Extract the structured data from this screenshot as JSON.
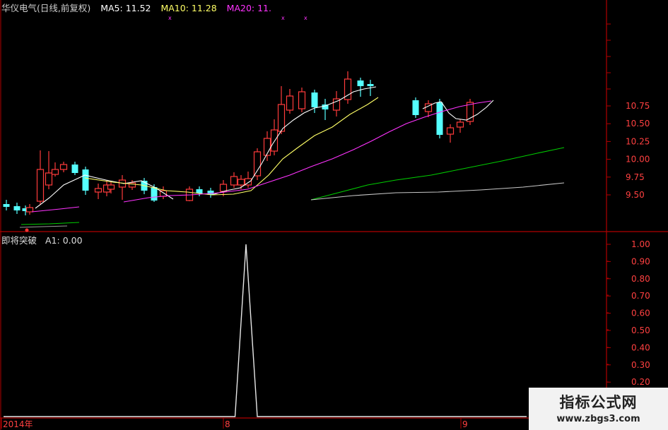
{
  "header": {
    "title": "华仪电气(日线,前复权)",
    "ma5": "MA5: 11.52",
    "ma10": "MA10: 11.28",
    "ma20": "MA20: 11."
  },
  "indicator": {
    "name": "即将突破",
    "value": "A1: 0.00"
  },
  "x_axis": {
    "labels": [
      "2014年",
      "8",
      "9"
    ]
  },
  "colors": {
    "background": "#000000",
    "frame": "#b00000",
    "candle_up": "#ff3b3b",
    "candle_down": "#55ffff",
    "ma5": "#ffffff",
    "ma10": "#ffff66",
    "ma20": "#ff33ff",
    "ma60": "#00cc00",
    "ma_other": "#c8c8c8",
    "title": "#d0d0d0"
  },
  "chart_data": [
    {
      "type": "candlestick",
      "title": "华仪电气(日线,前复权)",
      "y_ticks": [
        9.5,
        9.75,
        10.0,
        10.25,
        10.5,
        10.75
      ],
      "y_tick_labels": [
        "9.50",
        "9.75",
        "10.00",
        "10.25",
        "10.50",
        "10.75"
      ],
      "series": [
        {
          "name": "MA5",
          "color": "#ffffff"
        },
        {
          "name": "MA10",
          "color": "#ffff66"
        },
        {
          "name": "MA20",
          "color": "#ff33ff"
        }
      ]
    },
    {
      "type": "line",
      "title": "即将突破",
      "y_ticks": [
        0.2,
        0.3,
        0.4,
        0.5,
        0.6,
        0.7,
        0.8,
        0.9,
        1.0
      ],
      "y_tick_labels": [
        "0.20",
        "0.30",
        "0.40",
        "0.50",
        "0.60",
        "0.70",
        "0.80",
        "0.90",
        "1.00"
      ],
      "ylim": [
        0,
        1
      ],
      "series": [
        {
          "name": "A1",
          "values": [
            0,
            0,
            0,
            0,
            0,
            0,
            0,
            0,
            0,
            0,
            0,
            0,
            0,
            0,
            0,
            0,
            0,
            0,
            0,
            0,
            0,
            0,
            0,
            0,
            0,
            0,
            0,
            0,
            0,
            1,
            0,
            0,
            0,
            0,
            0,
            0,
            0,
            0,
            0,
            0,
            0,
            0,
            0,
            0,
            0,
            0,
            0,
            0,
            0,
            0,
            0,
            0,
            0,
            0,
            0,
            0,
            0,
            0,
            0,
            0,
            0,
            0
          ]
        }
      ]
    }
  ],
  "watermark": {
    "title": "指标公式网",
    "url": "www.zbgs3.com"
  }
}
